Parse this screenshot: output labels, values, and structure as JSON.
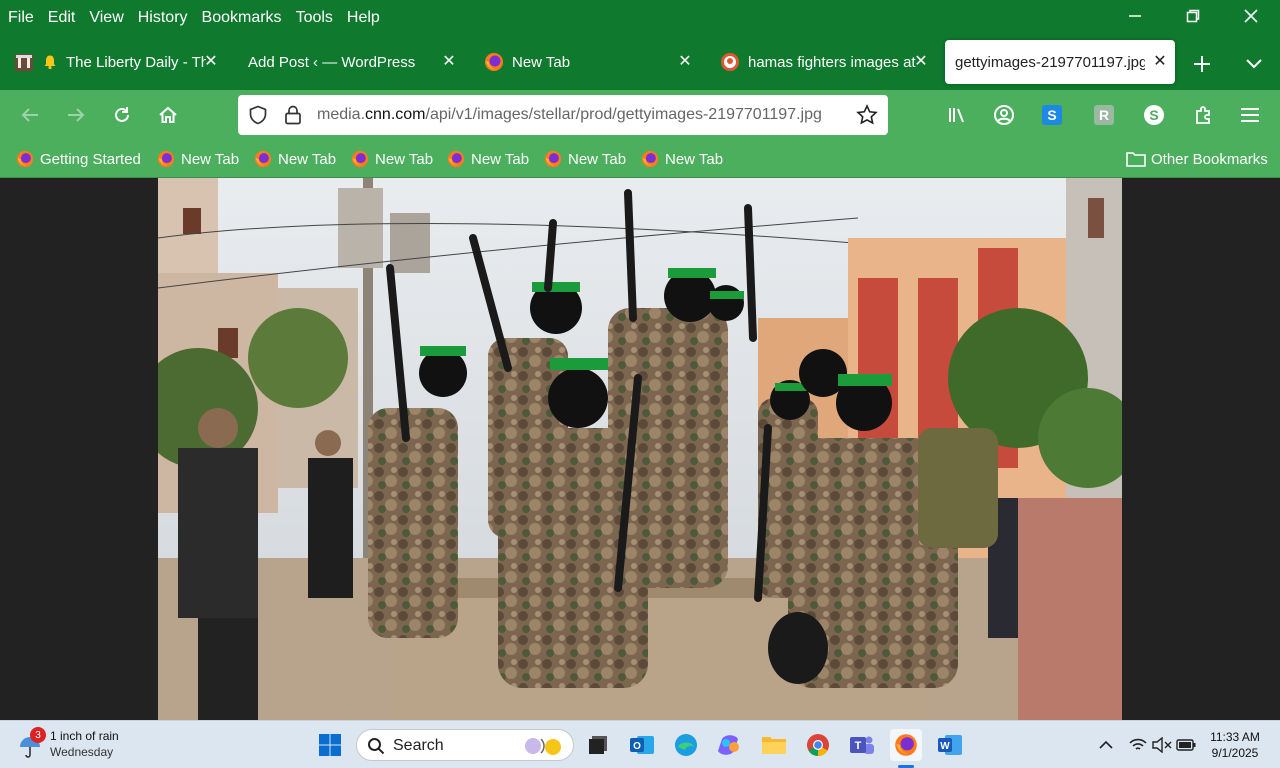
{
  "menu": [
    "File",
    "Edit",
    "View",
    "History",
    "Bookmarks",
    "Tools",
    "Help"
  ],
  "tabs": [
    {
      "title": "The Liberty Daily - Th",
      "icon": "news-site-icon"
    },
    {
      "title": "Add Post ‹ — WordPress",
      "icon": ""
    },
    {
      "title": "New Tab",
      "icon": "firefox-icon"
    },
    {
      "title": "hamas fighters images at",
      "icon": "duckduckgo-icon"
    },
    {
      "title": "gettyimages-2197701197.jpg",
      "icon": "",
      "active": true
    }
  ],
  "url": {
    "prefix": "media.",
    "domain": "cnn.com",
    "path": "/api/v1/images/stellar/prod/gettyimages-2197701197.jpg"
  },
  "bookmarks": [
    "Getting Started",
    "New Tab",
    "New Tab",
    "New Tab",
    "New Tab",
    "New Tab",
    "New Tab"
  ],
  "other_bookmarks": "Other Bookmarks",
  "taskbar": {
    "weather_badge": "3",
    "weather_line1": "1 inch of rain",
    "weather_line2": "Wednesday",
    "search_label": "Search",
    "time": "11:33 AM",
    "date": "9/1/2025"
  },
  "colors": {
    "chrome_dark": "#0f7a2e",
    "chrome_light": "#4caf5e",
    "taskbar": "#dbe6f0"
  }
}
